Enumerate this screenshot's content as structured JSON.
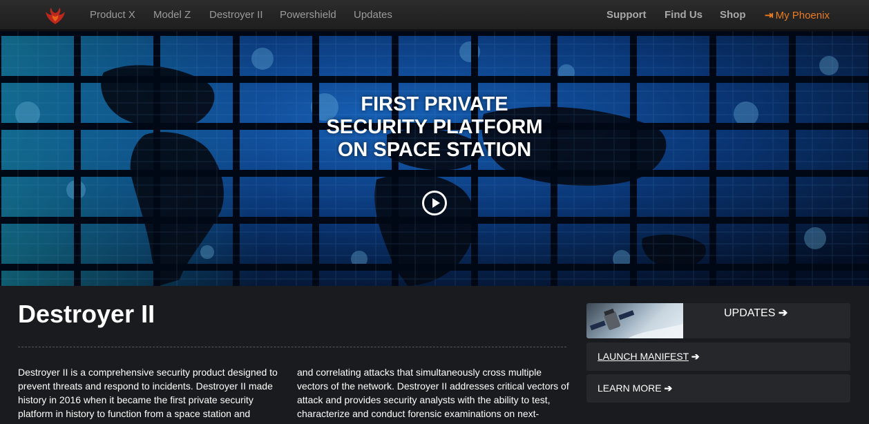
{
  "nav": {
    "left_items": [
      "Product X",
      "Model Z",
      "Destroyer II",
      "Powershield",
      "Updates"
    ],
    "right_items": [
      "Support",
      "Find Us",
      "Shop"
    ],
    "account_label": "My Phoenix",
    "account_icon": "sign-in-icon",
    "accent_color": "#e97b21"
  },
  "hero": {
    "title_lines": [
      "First private",
      "security platform",
      "on space station"
    ],
    "play_icon": "play-circle-icon"
  },
  "main": {
    "title": "Destroyer II",
    "col1": "Destroyer II is a comprehensive security product designed to prevent threats and respond to incidents. Destroyer II made history in 2016 when it became the first private security platform in history to function from a space station and",
    "col2": "and correlating attacks that simultaneously cross multiple vectors of the network. Destroyer II addresses critical vectors of attack and provides security analysts with the ability to test, characterize and conduct forensic examinations on next-"
  },
  "sidebar": {
    "updates_label": "UPDATES",
    "launch_label": "LAUNCH MANIFEST",
    "learn_label": "LEARN MORE",
    "arrow": "➔"
  }
}
